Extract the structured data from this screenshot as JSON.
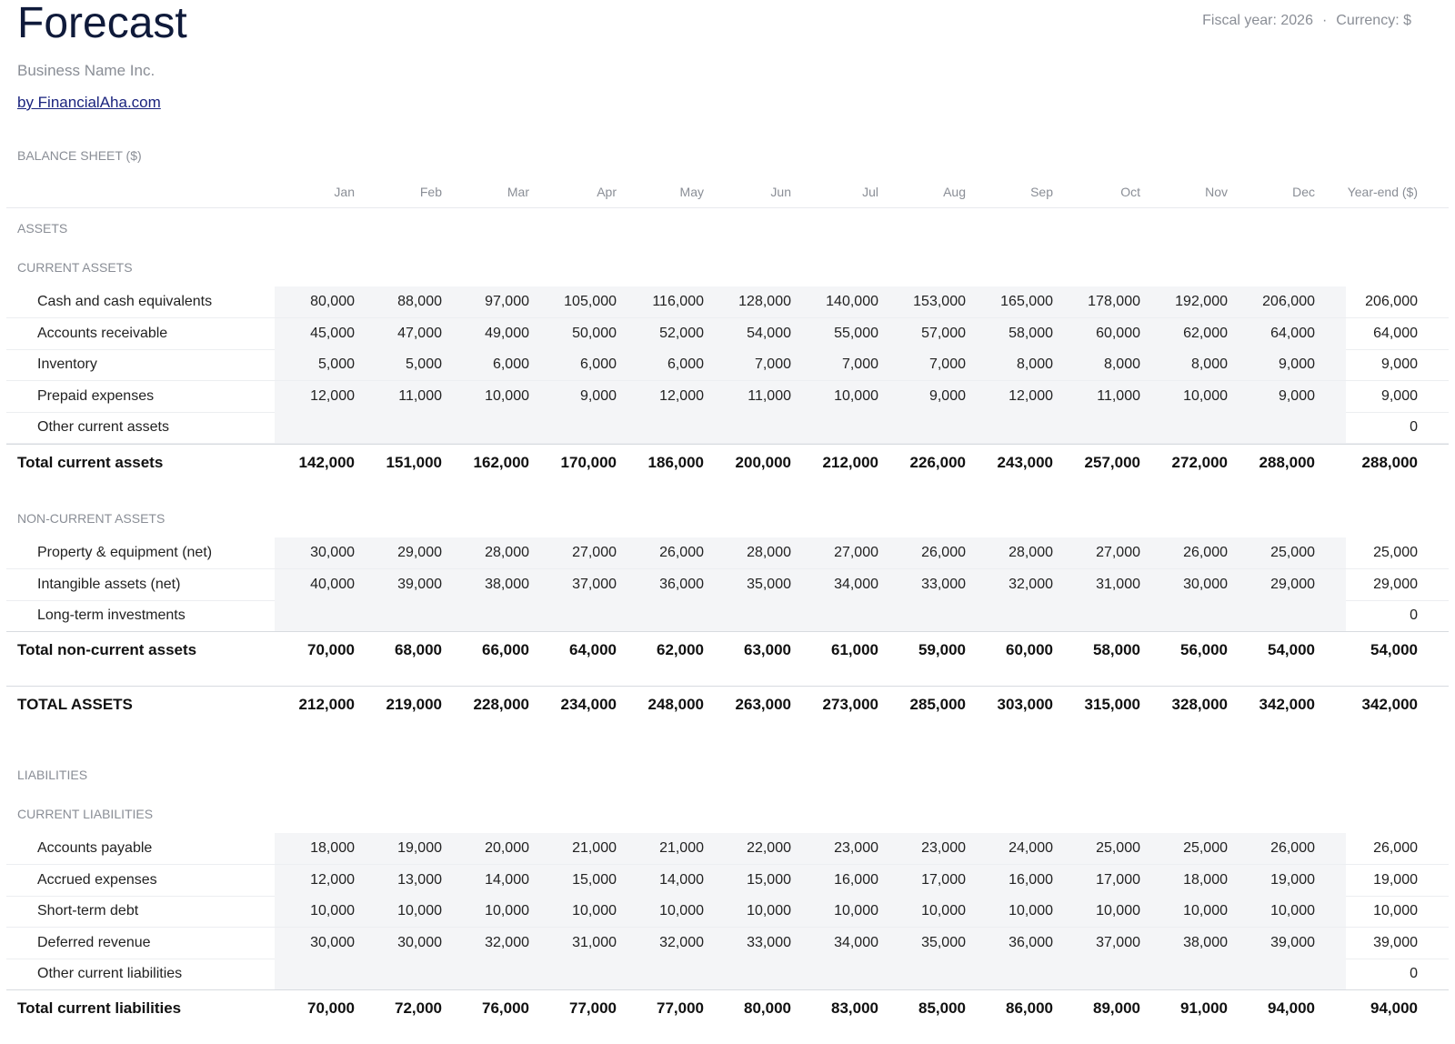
{
  "header": {
    "title": "Forecast",
    "company": "Business Name Inc.",
    "link": "by FinancialAha.com",
    "fiscal_year": "Fiscal year: 2026",
    "separator": "·",
    "currency": "Currency: $"
  },
  "sheet": {
    "title": "BALANCE SHEET ($)",
    "columns": [
      "Jan",
      "Feb",
      "Mar",
      "Apr",
      "May",
      "Jun",
      "Jul",
      "Aug",
      "Sep",
      "Oct",
      "Nov",
      "Dec",
      "Year-end ($)"
    ],
    "sections": {
      "assets": "ASSETS",
      "current_assets": "CURRENT ASSETS",
      "non_current_assets": "NON-CURRENT ASSETS",
      "liabilities": "LIABILITIES",
      "current_liabilities": "CURRENT LIABILITIES"
    },
    "current_assets": [
      {
        "label": "Cash and cash equivalents",
        "values": [
          "80,000",
          "88,000",
          "97,000",
          "105,000",
          "116,000",
          "128,000",
          "140,000",
          "153,000",
          "165,000",
          "178,000",
          "192,000",
          "206,000",
          "206,000"
        ]
      },
      {
        "label": "Accounts receivable",
        "values": [
          "45,000",
          "47,000",
          "49,000",
          "50,000",
          "52,000",
          "54,000",
          "55,000",
          "57,000",
          "58,000",
          "60,000",
          "62,000",
          "64,000",
          "64,000"
        ]
      },
      {
        "label": "Inventory",
        "values": [
          "5,000",
          "5,000",
          "6,000",
          "6,000",
          "6,000",
          "7,000",
          "7,000",
          "7,000",
          "8,000",
          "8,000",
          "8,000",
          "9,000",
          "9,000"
        ]
      },
      {
        "label": "Prepaid expenses",
        "values": [
          "12,000",
          "11,000",
          "10,000",
          "9,000",
          "12,000",
          "11,000",
          "10,000",
          "9,000",
          "12,000",
          "11,000",
          "10,000",
          "9,000",
          "9,000"
        ]
      },
      {
        "label": "Other current assets",
        "values": [
          "",
          "",
          "",
          "",
          "",
          "",
          "",
          "",
          "",
          "",
          "",
          "",
          "0"
        ]
      }
    ],
    "total_current_assets": {
      "label": "Total current assets",
      "values": [
        "142,000",
        "151,000",
        "162,000",
        "170,000",
        "186,000",
        "200,000",
        "212,000",
        "226,000",
        "243,000",
        "257,000",
        "272,000",
        "288,000",
        "288,000"
      ]
    },
    "non_current_assets": [
      {
        "label": "Property & equipment (net)",
        "values": [
          "30,000",
          "29,000",
          "28,000",
          "27,000",
          "26,000",
          "28,000",
          "27,000",
          "26,000",
          "28,000",
          "27,000",
          "26,000",
          "25,000",
          "25,000"
        ]
      },
      {
        "label": "Intangible assets (net)",
        "values": [
          "40,000",
          "39,000",
          "38,000",
          "37,000",
          "36,000",
          "35,000",
          "34,000",
          "33,000",
          "32,000",
          "31,000",
          "30,000",
          "29,000",
          "29,000"
        ]
      },
      {
        "label": "Long-term investments",
        "values": [
          "",
          "",
          "",
          "",
          "",
          "",
          "",
          "",
          "",
          "",
          "",
          "",
          "0"
        ]
      }
    ],
    "total_non_current_assets": {
      "label": "Total non-current assets",
      "values": [
        "70,000",
        "68,000",
        "66,000",
        "64,000",
        "62,000",
        "63,000",
        "61,000",
        "59,000",
        "60,000",
        "58,000",
        "56,000",
        "54,000",
        "54,000"
      ]
    },
    "total_assets": {
      "label": "TOTAL ASSETS",
      "values": [
        "212,000",
        "219,000",
        "228,000",
        "234,000",
        "248,000",
        "263,000",
        "273,000",
        "285,000",
        "303,000",
        "315,000",
        "328,000",
        "342,000",
        "342,000"
      ]
    },
    "current_liabilities": [
      {
        "label": "Accounts payable",
        "values": [
          "18,000",
          "19,000",
          "20,000",
          "21,000",
          "21,000",
          "22,000",
          "23,000",
          "23,000",
          "24,000",
          "25,000",
          "25,000",
          "26,000",
          "26,000"
        ]
      },
      {
        "label": "Accrued expenses",
        "values": [
          "12,000",
          "13,000",
          "14,000",
          "15,000",
          "14,000",
          "15,000",
          "16,000",
          "17,000",
          "16,000",
          "17,000",
          "18,000",
          "19,000",
          "19,000"
        ]
      },
      {
        "label": "Short-term debt",
        "values": [
          "10,000",
          "10,000",
          "10,000",
          "10,000",
          "10,000",
          "10,000",
          "10,000",
          "10,000",
          "10,000",
          "10,000",
          "10,000",
          "10,000",
          "10,000"
        ]
      },
      {
        "label": "Deferred revenue",
        "values": [
          "30,000",
          "30,000",
          "32,000",
          "31,000",
          "32,000",
          "33,000",
          "34,000",
          "35,000",
          "36,000",
          "37,000",
          "38,000",
          "39,000",
          "39,000"
        ]
      },
      {
        "label": "Other current liabilities",
        "values": [
          "",
          "",
          "",
          "",
          "",
          "",
          "",
          "",
          "",
          "",
          "",
          "",
          "0"
        ]
      }
    ],
    "total_current_liabilities": {
      "label": "Total current liabilities",
      "values": [
        "70,000",
        "72,000",
        "76,000",
        "77,000",
        "77,000",
        "80,000",
        "83,000",
        "85,000",
        "86,000",
        "89,000",
        "91,000",
        "94,000",
        "94,000"
      ]
    }
  }
}
